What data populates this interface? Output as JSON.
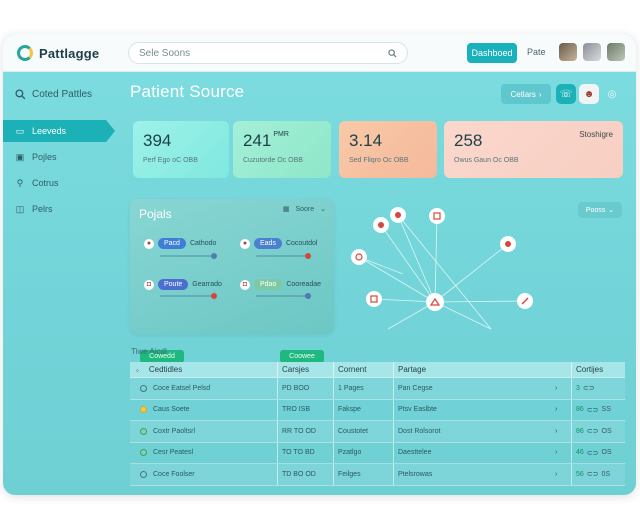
{
  "app": {
    "name": "Pattlagge",
    "search_placeholder": "Sele Soons",
    "primary_button": "Dashboed",
    "link": "Pate"
  },
  "sidebar": {
    "header": "Coted Pattles",
    "items": [
      {
        "label": "Leeveds",
        "icon": "dashboard-icon",
        "active": true
      },
      {
        "label": "Pojles",
        "icon": "projects-icon",
        "active": false
      },
      {
        "label": "Cotrus",
        "icon": "contacts-icon",
        "active": false
      },
      {
        "label": "Pelrs",
        "icon": "reports-icon",
        "active": false
      }
    ]
  },
  "header": {
    "title": "Patient Source",
    "button_label": "Cetlars"
  },
  "stats": [
    {
      "value": "394",
      "unit": "",
      "sub": "Perf Ego oC OBB"
    },
    {
      "value": "241",
      "unit": "PMR",
      "sub": "Cuzutorde Oc OBB"
    },
    {
      "value": "3.14",
      "unit": "",
      "sub": "Sed Fliqro Oc OBB"
    },
    {
      "value": "258",
      "unit": "",
      "sub": "Owus Gaun Oc OBB",
      "corner": "Stoshigre"
    }
  ],
  "projects": {
    "title": "Pojals",
    "sort_label": "Soore",
    "nodes": [
      {
        "pill": "Pacd",
        "label": "Cathodo"
      },
      {
        "pill": "Eads",
        "label": "Cocoutdol"
      },
      {
        "pill": "Poute",
        "label": "Gearrado"
      },
      {
        "pill": "Pdao",
        "label": "Cooreadae"
      }
    ],
    "buttons": [
      "Cowedd",
      "Coowee"
    ]
  },
  "network": {
    "button_label": "Pooss"
  },
  "table": {
    "title": "Tiwe Aicdl",
    "columns": [
      "Cedtidles",
      "Carsjes",
      "Cornent",
      "Partage",
      "Cortijes"
    ],
    "rows": [
      {
        "name": "Coce Eatsel Pelsd",
        "icon": "o",
        "col2": "PD BOO",
        "col3": "1 Pages",
        "col4": "Pan Cegse",
        "cnt": "3",
        "tail": ""
      },
      {
        "name": "Caus Soete",
        "icon": "y",
        "col2": "TRO ISB",
        "col3": "Fakspe",
        "col4": "Ptsv Easlbte",
        "cnt": "86",
        "tail": "SS"
      },
      {
        "name": "Coxtr Paoltsrl",
        "icon": "g",
        "col2": "RR TO OD",
        "col3": "Coustotet",
        "col4": "Dost Rolsorot",
        "cnt": "86",
        "tail": "OS"
      },
      {
        "name": "Cesr Peatesl",
        "icon": "g",
        "col2": "TO TO BD",
        "col3": "Pzatlgo",
        "col4": "Daesttelee",
        "cnt": "46",
        "tail": "OS"
      },
      {
        "name": "Coce Foolser",
        "icon": "o",
        "col2": "TD BO OD",
        "col3": "Feilges",
        "col4": "Ptelsrowas",
        "cnt": "56",
        "tail": "0S"
      }
    ]
  }
}
